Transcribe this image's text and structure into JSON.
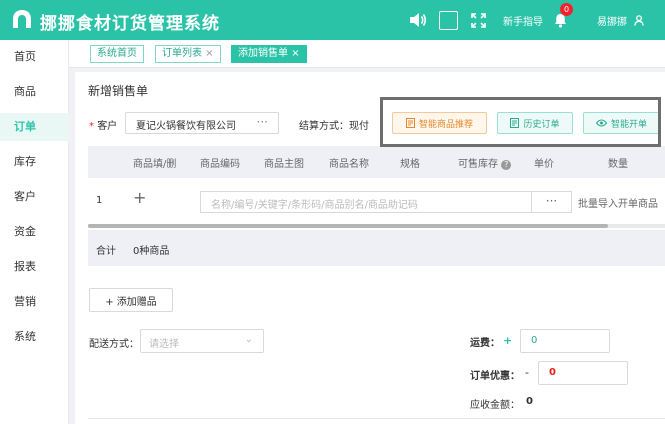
{
  "app": {
    "title": "挪挪食材订货管理系统",
    "guide_label": "新手指导",
    "notification_count": "0",
    "user_name": "易挪挪",
    "brand_color": "#2bc3a8"
  },
  "sidebar": {
    "items": [
      {
        "label": "首页"
      },
      {
        "label": "商品"
      },
      {
        "label": "订单"
      },
      {
        "label": "库存"
      },
      {
        "label": "客户"
      },
      {
        "label": "资金"
      },
      {
        "label": "报表"
      },
      {
        "label": "营销"
      },
      {
        "label": "系统"
      }
    ],
    "active_index": 2
  },
  "tabs": [
    {
      "label": "系统首页",
      "closable": false
    },
    {
      "label": "订单列表",
      "closable": true
    },
    {
      "label": "添加销售单",
      "closable": true
    }
  ],
  "form": {
    "section_title": "新增销售单",
    "required_mark": "*",
    "customer_label": "客户",
    "customer_value": "夏记火锅餐饮有限公司",
    "customer_dots": "···",
    "settlement_label": "结算方式：",
    "settlement_value": "现付",
    "buttons": {
      "smart_recommend": "智能商品推荐",
      "history_orders": "历史订单",
      "smart_open": "智能开单"
    }
  },
  "table": {
    "headers": [
      "商品填/删",
      "商品编码",
      "商品主图",
      "商品名称",
      "规格",
      "可售库存",
      "单价",
      "数量"
    ],
    "row_index": "1",
    "add_symbol": "+",
    "search_placeholder": "名称/编号/关键字/条形码/商品别名/商品助记码",
    "dots": "···",
    "batch_import": "批量导入开单商品",
    "summary_label": "合计",
    "summary_value": "0种商品"
  },
  "extras": {
    "add_gift": "+ 添加赠品",
    "delivery_label": "配送方式：",
    "delivery_placeholder": "请选择",
    "freight_label": "运费：",
    "freight_sign": "+",
    "freight_value": "0",
    "discount_label": "订单优惠：",
    "discount_sign": "-",
    "discount_value": "0",
    "receivable_label": "应收金额：",
    "receivable_value": "0"
  }
}
